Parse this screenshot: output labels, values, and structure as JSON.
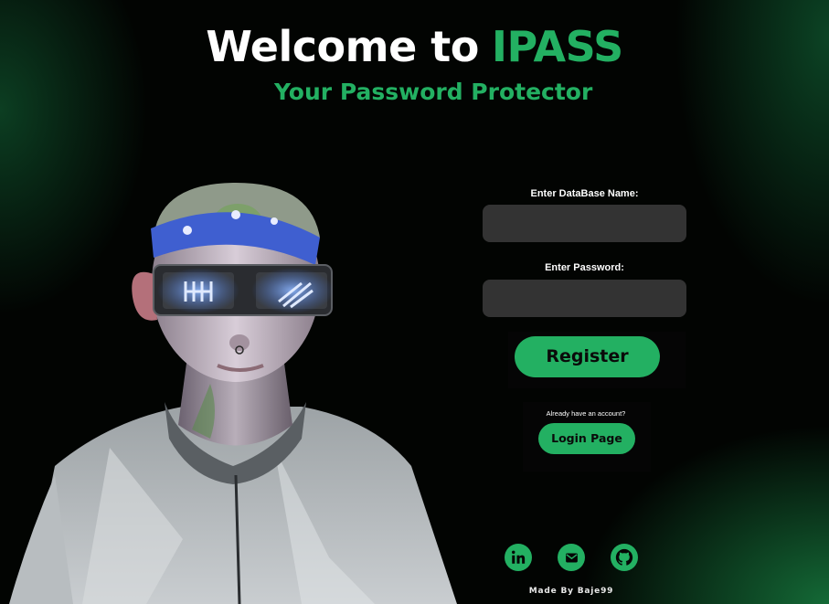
{
  "hero": {
    "title_prefix": "Welcome to",
    "title_brand": "IPASS",
    "subtitle": "Your Password Protector"
  },
  "form": {
    "database_label": "Enter DataBase Name:",
    "database_value": "",
    "password_label": "Enter Password:",
    "password_value": "",
    "register_label": "Register"
  },
  "login": {
    "prompt": "Already have an account?",
    "button_label": "Login Page"
  },
  "social": [
    {
      "icon": "linkedin-icon"
    },
    {
      "icon": "mail-icon"
    },
    {
      "icon": "github-icon"
    }
  ],
  "footer": {
    "credit": "Made By Baje99"
  },
  "colors": {
    "accent": "#23b062",
    "background": "#000000",
    "input": "#333333"
  }
}
